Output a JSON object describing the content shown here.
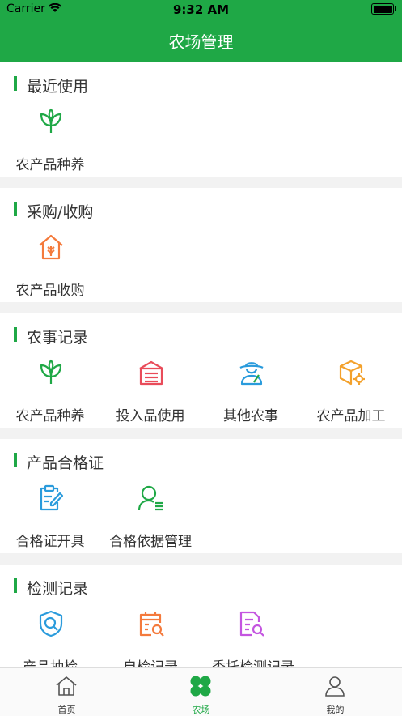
{
  "status": {
    "carrier": "Carrier",
    "time": "9:32 AM"
  },
  "nav": {
    "title": "农场管理"
  },
  "sections": {
    "recent": {
      "title": "最近使用",
      "items": [
        "农产品种养"
      ]
    },
    "purchase": {
      "title": "采购/收购",
      "items": [
        "农产品收购"
      ]
    },
    "farm_record": {
      "title": "农事记录",
      "items": [
        "农产品种养",
        "投入品使用",
        "其他农事",
        "农产品加工"
      ]
    },
    "certificate": {
      "title": "产品合格证",
      "items": [
        "合格证开具",
        "合格依据管理"
      ]
    },
    "testing": {
      "title": "检测记录",
      "items": [
        "产品抽检",
        "自检记录",
        "委托检测记录"
      ]
    }
  },
  "tabs": [
    "首页",
    "农场",
    "我的"
  ],
  "colors": {
    "brand": "#1fa846",
    "orange": "#f47a3c",
    "red": "#e94c5a",
    "blue": "#2a9bdc",
    "amber": "#f3a12c",
    "purple": "#c455e0"
  },
  "icons": [
    "sprout-icon",
    "house-harvest-icon",
    "crate-icon",
    "farmer-icon",
    "box-gear-icon",
    "clipboard-edit-icon",
    "user-list-icon",
    "shield-search-icon",
    "calendar-search-icon",
    "document-search-icon"
  ]
}
